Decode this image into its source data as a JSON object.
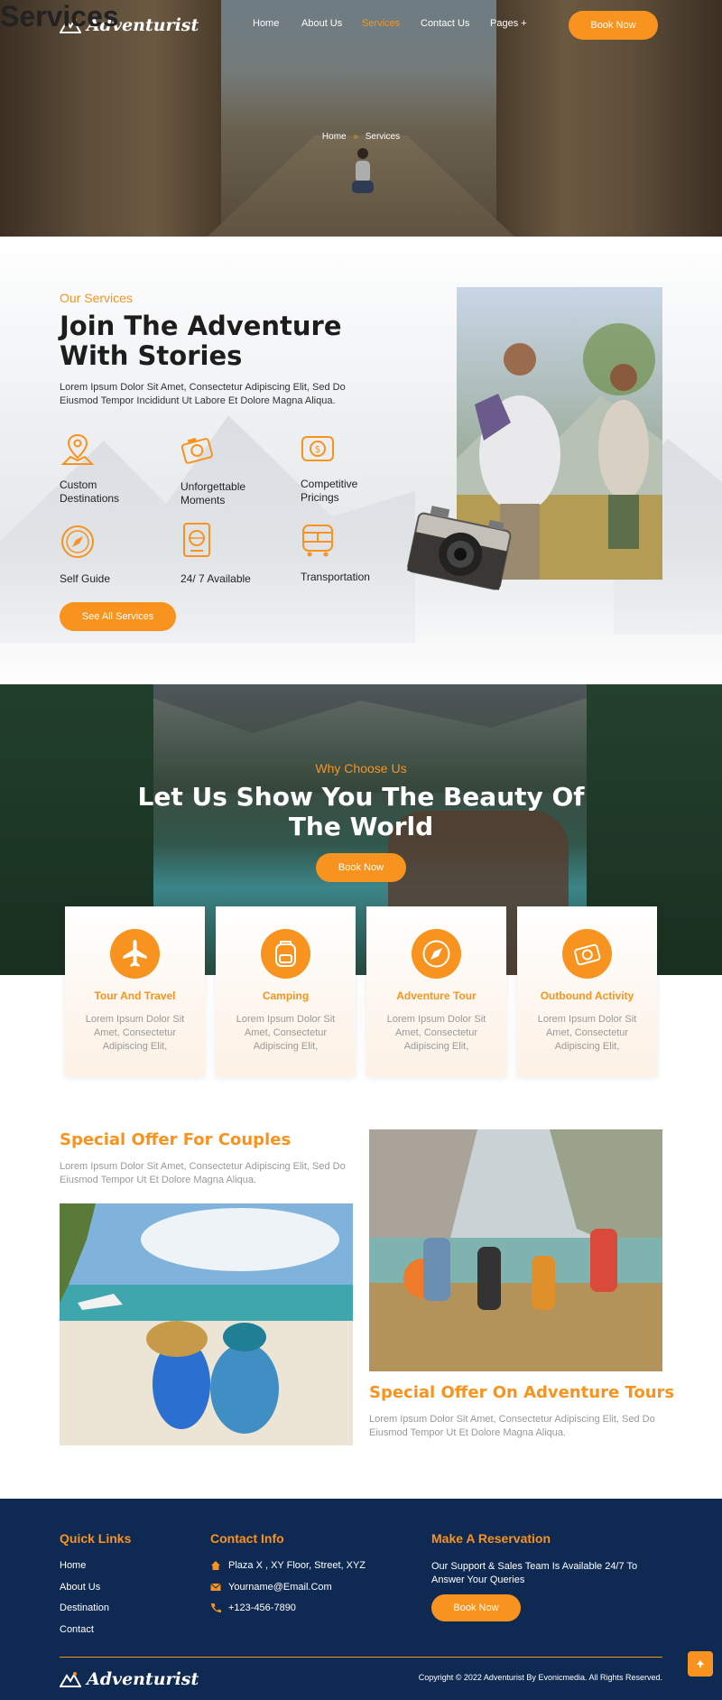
{
  "header": {
    "logo_text": "Adventurist",
    "nav": [
      "Home",
      "About Us",
      "Services",
      "Contact Us",
      "Pages +"
    ],
    "book_now": "Book Now",
    "page_title": "Services",
    "breadcrumb_home": "Home",
    "breadcrumb_sep": "»",
    "breadcrumb_current": "Services"
  },
  "services": {
    "eyebrow": "Our Services",
    "title_line1": "Join The Adventure",
    "title_line2": "With Stories",
    "desc": "Lorem Ipsum Dolor Sit Amet, Consectetur Adipiscing Elit, Sed Do Eiusmod Tempor Incididunt Ut Labore Et Dolore Magna Aliqua.",
    "features": [
      {
        "label": "Custom Destinations",
        "icon": "map-location-icon"
      },
      {
        "label": "Unforgettable Moments",
        "icon": "camera-icon"
      },
      {
        "label": "Competitive Pricings",
        "icon": "price-tag-icon"
      },
      {
        "label": "Self Guide",
        "icon": "compass-icon"
      },
      {
        "label": "24/ 7 Available",
        "icon": "passport-icon"
      },
      {
        "label": "Transportation",
        "icon": "bus-icon"
      }
    ],
    "cta": "See All Services"
  },
  "why": {
    "eyebrow": "Why Choose Us",
    "title_line1": "Let Us Show You The Beauty Of",
    "title_line2": "The World",
    "cta": "Book Now",
    "cards": [
      {
        "title": "Tour And Travel",
        "desc": "Lorem Ipsum Dolor Sit Amet, Consectetur Adipiscing Elit,",
        "icon": "airplane-icon"
      },
      {
        "title": "Camping",
        "desc": "Lorem Ipsum Dolor Sit Amet, Consectetur Adipiscing Elit,",
        "icon": "backpack-icon"
      },
      {
        "title": "Adventure Tour",
        "desc": "Lorem Ipsum Dolor Sit Amet, Consectetur Adipiscing Elit,",
        "icon": "compass-icon"
      },
      {
        "title": "Outbound Activity",
        "desc": "Lorem Ipsum Dolor Sit Amet, Consectetur Adipiscing Elit,",
        "icon": "camera-icon"
      }
    ]
  },
  "offers": {
    "couples_title": "Special Offer For Couples",
    "couples_desc": "Lorem Ipsum Dolor Sit Amet, Consectetur Adipiscing Elit, Sed Do Eiusmod Tempor  Ut Et Dolore Magna Aliqua.",
    "tours_title": "Special Offer On Adventure Tours",
    "tours_desc": "Lorem Ipsum Dolor Sit Amet, Consectetur Adipiscing Elit, Sed Do Eiusmod Tempor  Ut Et Dolore Magna Aliqua."
  },
  "footer": {
    "quick_links_title": "Quick Links",
    "quick_links": [
      "Home",
      "About Us",
      "Destination",
      "Contact"
    ],
    "contact_title": "Contact Info",
    "contact": [
      {
        "text": "Plaza X , XY Floor, Street, XYZ",
        "icon": "home-icon"
      },
      {
        "text": "Yourname@Email.Com",
        "icon": "envelope-icon"
      },
      {
        "text": "+123-456-7890",
        "icon": "phone-icon"
      }
    ],
    "reservation_title": "Make A Reservation",
    "reservation_desc": "Our Support & Sales Team Is Available 24/7 To Answer Your Queries",
    "reservation_cta": "Book Now",
    "logo_text": "Adventurist",
    "copyright": "Copyright © 2022 Adventurist By Evonicmedia. All Rights Reserved."
  },
  "colors": {
    "accent": "#f7931e",
    "footer_bg": "#0f2a52"
  }
}
